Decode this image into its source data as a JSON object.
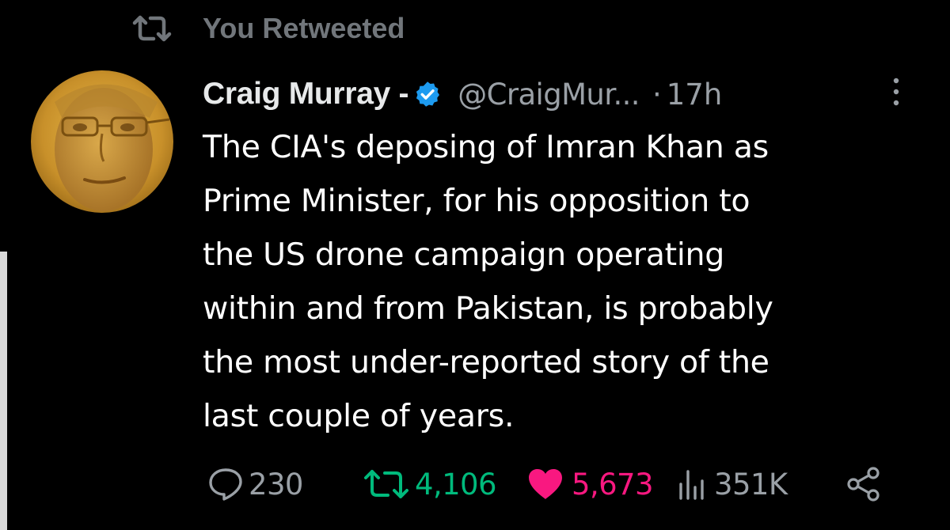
{
  "retweet_header": {
    "label": "You Retweeted",
    "icon": "retweet-icon"
  },
  "tweet": {
    "author": {
      "display_name": "Craig Murray -",
      "handle": "@CraigMur...",
      "verified": true,
      "avatar": "avatar"
    },
    "separator": "·",
    "timestamp": "17h",
    "more_icon": "more-icon",
    "text_lines": [
      "The CIA's deposing of Imran Khan as",
      "Prime Minister, for his opposition to",
      "the US drone campaign operating",
      "within and from Pakistan, is probably",
      "the most under-reported story of the",
      "last couple of years."
    ]
  },
  "actions": {
    "replies": {
      "icon": "reply-icon",
      "count": "230"
    },
    "retweets": {
      "icon": "retweet-icon",
      "count": "4,106"
    },
    "likes": {
      "icon": "heart-icon",
      "count": "5,673"
    },
    "views": {
      "icon": "views-icon",
      "count": "351K"
    },
    "share": {
      "icon": "share-icon"
    }
  },
  "colors": {
    "background": "#000000",
    "text_primary": "#ffffff",
    "text_secondary": "#9aa0a6",
    "verified_blue": "#1d9bf0",
    "retweet_green": "#00ba7c",
    "like_pink": "#f91880"
  }
}
